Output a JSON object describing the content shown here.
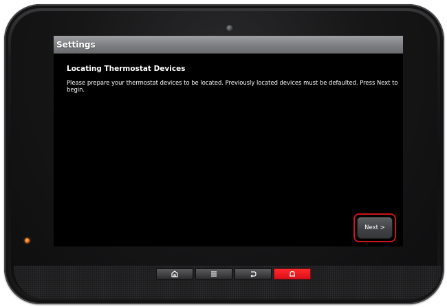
{
  "screen": {
    "title": "Settings",
    "heading": "Locating Thermostat Devices",
    "message": "Please prepare your thermostat devices to be located. Previously located devices must be defaulted. Press Next to begin.",
    "next_label": "Next >"
  },
  "hardware_buttons": [
    {
      "name": "home",
      "icon": "home-icon"
    },
    {
      "name": "menu",
      "icon": "menu-icon"
    },
    {
      "name": "back",
      "icon": "back-icon"
    },
    {
      "name": "emergency",
      "icon": "alarm-bell-icon",
      "color": "#e0141d"
    }
  ],
  "colors": {
    "titlebar": "#7d7f82",
    "screen_background": "#000000",
    "highlight": "#d0121b",
    "status_led": "#e07218"
  }
}
